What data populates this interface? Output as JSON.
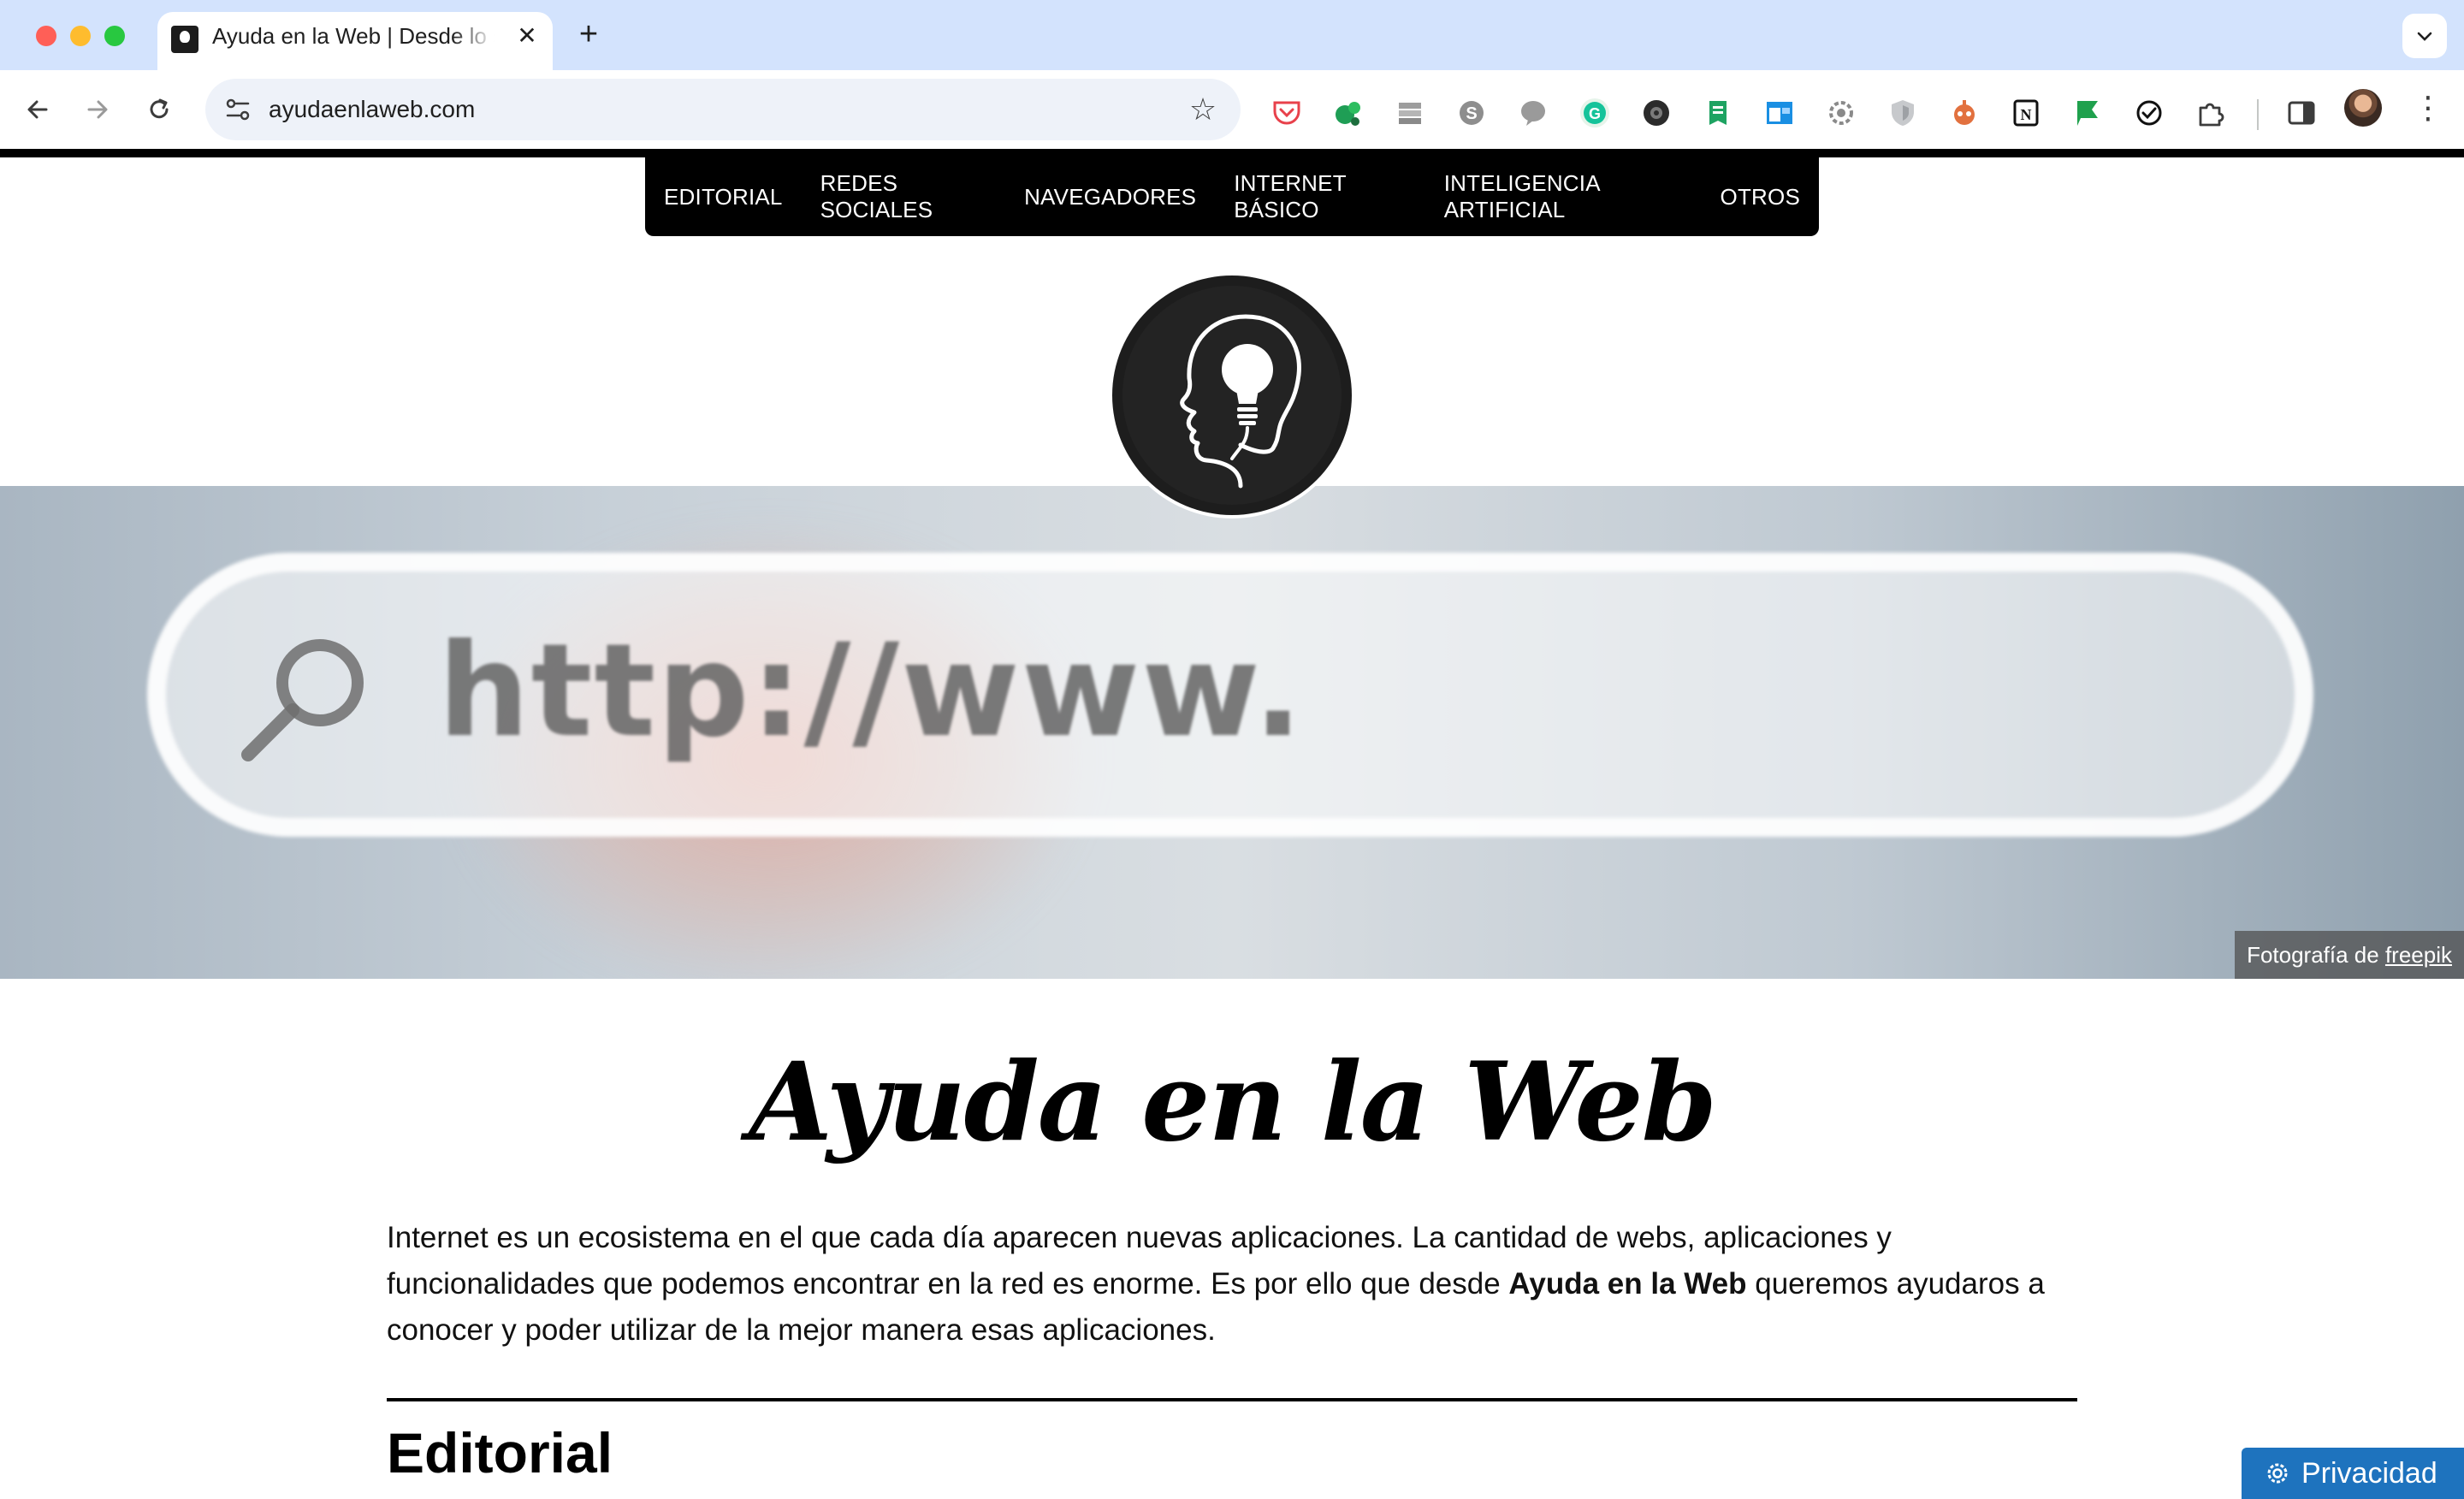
{
  "browser": {
    "tab_title": "Ayuda en la Web | Desde lo so",
    "tab_close": "✕",
    "new_tab": "+",
    "url": "ayudaenlaweb.com",
    "extensions": [
      "pocket-icon",
      "evernote-icon",
      "stack-icon",
      "skype-icon",
      "chat-icon",
      "grammarly-icon",
      "camera-icon",
      "sheet-icon",
      "window-icon",
      "gear-flower-icon",
      "shield-icon",
      "bot-icon",
      "notion-icon",
      "flag-icon",
      "check-circle-icon",
      "puzzle-icon"
    ],
    "menu_glyph": "⋮",
    "star_glyph": "☆"
  },
  "nav": {
    "items": [
      "EDITORIAL",
      "REDES SOCIALES",
      "NAVEGADORES",
      "INTERNET BÁSICO",
      "INTELIGENCIA ARTIFICIAL",
      "OTROS"
    ]
  },
  "hero": {
    "text": "http://www.",
    "credit_prefix": "Fotografía de ",
    "credit_link": "freepik"
  },
  "main": {
    "title": "Ayuda en la Web",
    "intro_before": "Internet es un ecosistema en el que cada día aparecen nuevas aplicaciones. La cantidad de webs, aplicaciones y funcionalidades que podemos encontrar en la red es enorme. Es por ello que desde ",
    "intro_bold": "Ayuda en la Web",
    "intro_after": " queremos ayudaros a conocer y poder utilizar de la mejor manera esas aplicaciones.",
    "section_heading": "Editorial"
  },
  "privacy": {
    "label": "Privacidad"
  },
  "colors": {
    "tabbar": "#d3e3fd",
    "nav_bg": "#000000",
    "privacy_bg": "#1e73be"
  }
}
